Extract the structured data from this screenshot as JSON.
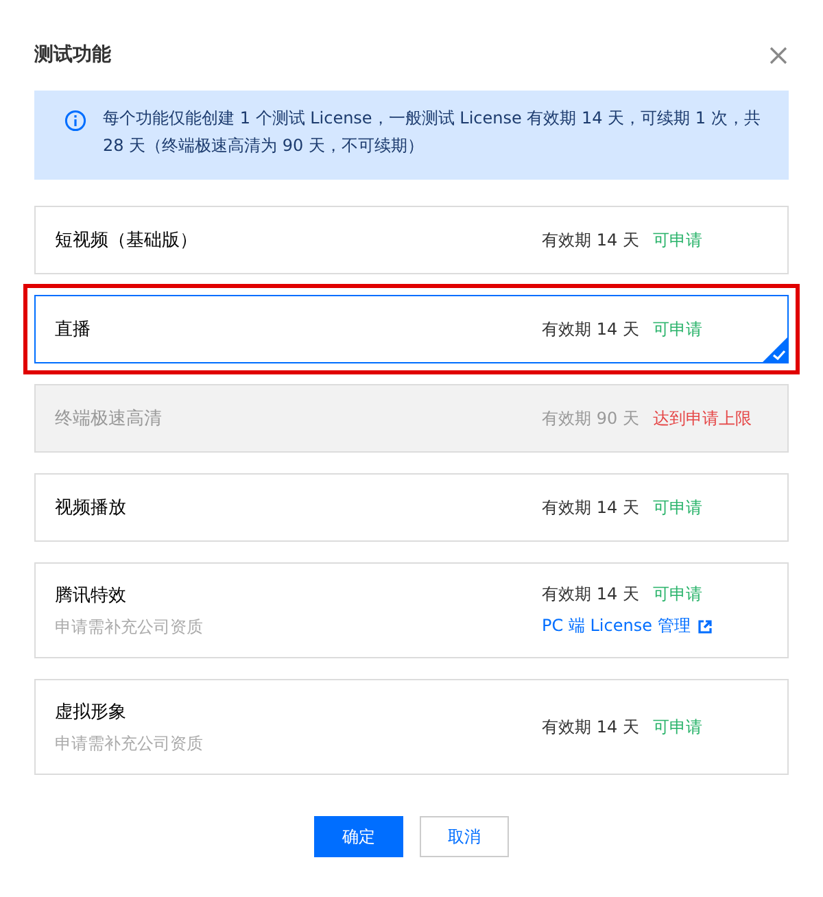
{
  "dialog": {
    "title": "测试功能"
  },
  "notice": "每个功能仅能创建 1 个测试 License，一般测试 License 有效期 14 天，可续期 1 次，共 28 天（终端极速高清为 90 天，不可续期）",
  "features": [
    {
      "name": "短视频（基础版）",
      "validity": "有效期 14 天",
      "status": "可申请",
      "kind": "available",
      "selected": false,
      "disabled": false,
      "annotated": false
    },
    {
      "name": "直播",
      "validity": "有效期 14 天",
      "status": "可申请",
      "kind": "available",
      "selected": true,
      "disabled": false,
      "annotated": true
    },
    {
      "name": "终端极速高清",
      "validity": "有效期 90 天",
      "status": "达到申请上限",
      "kind": "limit",
      "selected": false,
      "disabled": true,
      "annotated": false
    },
    {
      "name": "视频播放",
      "validity": "有效期 14 天",
      "status": "可申请",
      "kind": "available",
      "selected": false,
      "disabled": false,
      "annotated": false
    },
    {
      "name": "腾讯特效",
      "note": "申请需补充公司资质",
      "validity": "有效期 14 天",
      "status": "可申请",
      "kind": "available",
      "link": "PC 端 License 管理",
      "selected": false,
      "disabled": false,
      "annotated": false
    },
    {
      "name": "虚拟形象",
      "note": "申请需补充公司资质",
      "validity": "有效期 14 天",
      "status": "可申请",
      "kind": "available",
      "selected": false,
      "disabled": false,
      "annotated": false
    }
  ],
  "buttons": [
    {
      "label": "确定",
      "kind": "primary"
    },
    {
      "label": "取消",
      "kind": "secondary"
    }
  ]
}
